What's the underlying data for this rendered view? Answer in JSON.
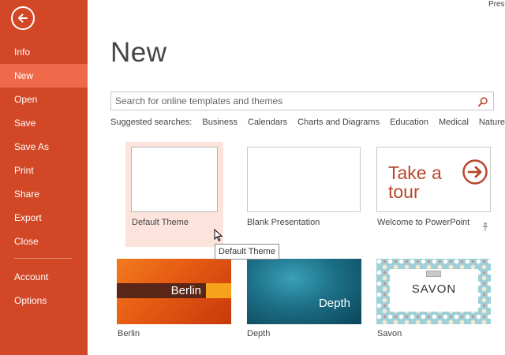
{
  "app": {
    "title": "Prese"
  },
  "sidebar": {
    "back_icon": "arrow-left-circle-icon",
    "items": [
      {
        "label": "Info"
      },
      {
        "label": "New",
        "active": true
      },
      {
        "label": "Open"
      },
      {
        "label": "Save"
      },
      {
        "label": "Save As"
      },
      {
        "label": "Print"
      },
      {
        "label": "Share"
      },
      {
        "label": "Export"
      },
      {
        "label": "Close"
      },
      {
        "label": "Account"
      },
      {
        "label": "Options"
      }
    ]
  },
  "main": {
    "title": "New",
    "search": {
      "placeholder": "Search for online templates and themes",
      "value": ""
    },
    "suggested": {
      "label": "Suggested searches:",
      "links": [
        "Business",
        "Calendars",
        "Charts and Diagrams",
        "Education",
        "Medical",
        "Nature"
      ]
    },
    "templates": [
      {
        "name": "Default Theme"
      },
      {
        "name": "Blank Presentation"
      },
      {
        "name": "Welcome to PowerPoint",
        "thumb_text": "Take a tour"
      },
      {
        "name": "Berlin",
        "thumb_text": "Berlin"
      },
      {
        "name": "Depth",
        "thumb_text": "Depth"
      },
      {
        "name": "Savon",
        "thumb_text": "SAVON"
      }
    ],
    "tooltip": "Default Theme"
  },
  "colors": {
    "sidebar": "#D24726",
    "sidebar_active": "#EF6A4B",
    "hover_tile": "#FCE4DD",
    "accent_text": "#B7472A"
  }
}
